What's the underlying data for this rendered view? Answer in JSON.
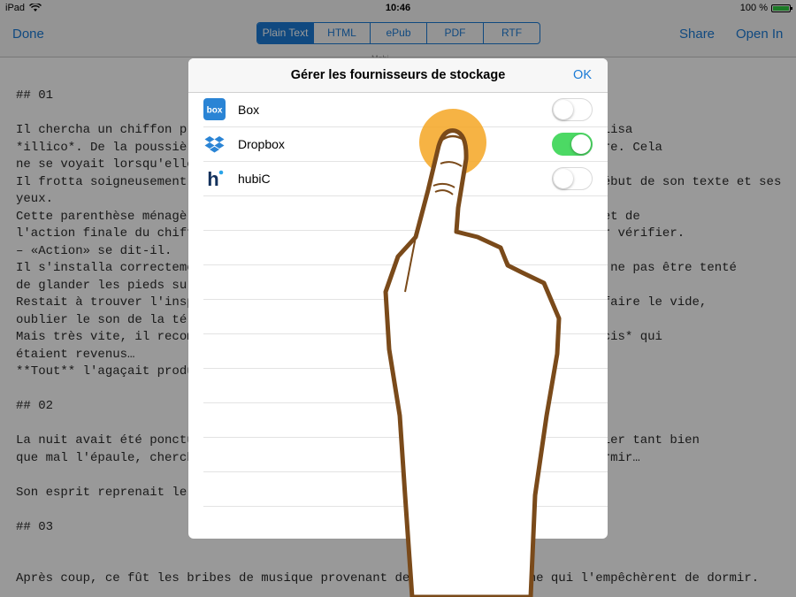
{
  "status_bar": {
    "device": "iPad",
    "time": "10:46",
    "battery": "100 %"
  },
  "nav": {
    "done": "Done",
    "share": "Share",
    "open_in": "Open In",
    "segments": [
      "Plain Text",
      "HTML",
      "ePub",
      "PDF",
      "RTF"
    ],
    "sub_label": "Mobi"
  },
  "editor": {
    "text": "## 01\n\nIl chercha un chiffon propre et mouilla. C'est avec un certain dégoût qu'il utilisa\n*illico*. De la poussière s'amoncelait sur ses écrans et sur sa tablette à écrire. Cela\nne se voyait lorsqu'elle était éteinte.\nIl frotta soigneusement avant de s'installer pour relire une dernière fois le début de son texte et ses\nyeux.\nCette parenthèse ménagère lui fit du bien. Il alluma les applications *ad hoc* et de\nl'action finale du chiffon, il passa le doigt une dernière fois sur l'écran pour vérifier.\n– «Action» se dit-il.\nIl s'installa correctement, le dos droit, il coupa le wifi et le téléphone pour ne pas être tenté\nde glander les pieds sur le bureau.\nRestait à trouver l'inspiration. Il savait exactement ce qu'il fallait faire : faire le vide,\noublier le son de la télé du voisin.\nMais très vite, il recommença à tapoter sur les raccourcis, les fameux *Raccourcis* qui\nétaient revenus…\n**Tout** l'agaçait produire.\n\n## 02\n\nLa nuit avait été ponctuée de réveils, il avait passé la plus grande partie, caler tant bien\nque mal l'épaule, chercher une position confortable pour pouvoir enfin se rendormir…\n\nSon esprit reprenait le dessus.\n\n## 03\n\n\nAprès coup, ce fût les bribes de musique provenant de la maison voisine qui l'empêchèrent de dormir."
  },
  "modal": {
    "title": "Gérer les fournisseurs de stockage",
    "ok": "OK",
    "providers": [
      {
        "name": "Box",
        "icon": "box-icon",
        "enabled": false,
        "icon_color": "#2a84d5"
      },
      {
        "name": "Dropbox",
        "icon": "dropbox-icon",
        "enabled": true,
        "icon_color": "#2a84d5"
      },
      {
        "name": "hubiC",
        "icon": "hubic-icon",
        "enabled": false,
        "icon_color": "#13315c"
      }
    ]
  },
  "colors": {
    "accent": "#1b7bd6",
    "toggle_on": "#4cd964",
    "finger_outline": "#7a4a1a",
    "touch_point": "#f5a623"
  }
}
